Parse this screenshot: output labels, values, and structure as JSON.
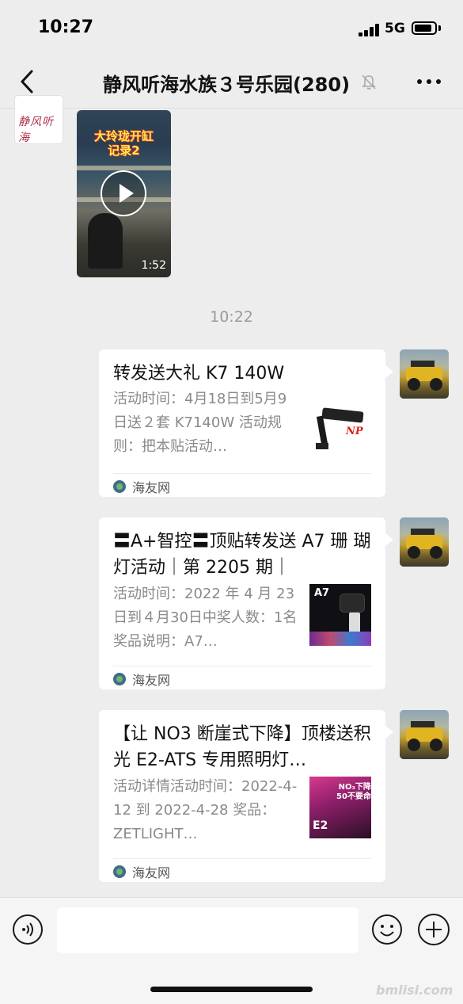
{
  "status_bar": {
    "time": "10:27",
    "network": "5G"
  },
  "nav": {
    "title": "静风听海水族３号乐园(280)"
  },
  "group_avatar": {
    "text": "静风听海"
  },
  "video": {
    "caption_line1": "大玲珑开缸",
    "caption_line2": "记录2",
    "duration": "1:52"
  },
  "timestamp": "10:22",
  "cards": [
    {
      "title": "转发送大礼 K7 140W",
      "description": "活动时间：4月18日到5月9日送２套 K7140W 活动规则：把本贴活动…",
      "source": "海友网",
      "thumb_logo": "NP"
    },
    {
      "title": "〓A+智控〓顶贴转发送 A7 珊 瑚灯活动｜第 2205 期｜",
      "description": "活动时间：2022 年 4 月 23日到４月30日中奖人数：1名奖品说明：A7…",
      "source": "海友网",
      "thumb_logo": "A7"
    },
    {
      "title": "【让 NO3 断崖式下降】顶楼送积光 E2-ATS 专用照明灯…",
      "description": "活动详情活动时间：2022-4-12 到 2022-4-28 奖品：ZETLIGHT…",
      "source": "海友网",
      "thumb_logo": "E2",
      "thumb_badge_line1": "NO₃下降",
      "thumb_badge_line2": "50不要命"
    }
  ],
  "input": {
    "placeholder": ""
  },
  "watermark": "bmlisi.com",
  "icons": {
    "back": "chevron-left-icon",
    "mute": "bell-off-icon",
    "more": "more-dots-icon",
    "voice": "voice-icon",
    "emoji": "emoji-icon",
    "plus": "plus-icon",
    "play": "play-icon"
  }
}
